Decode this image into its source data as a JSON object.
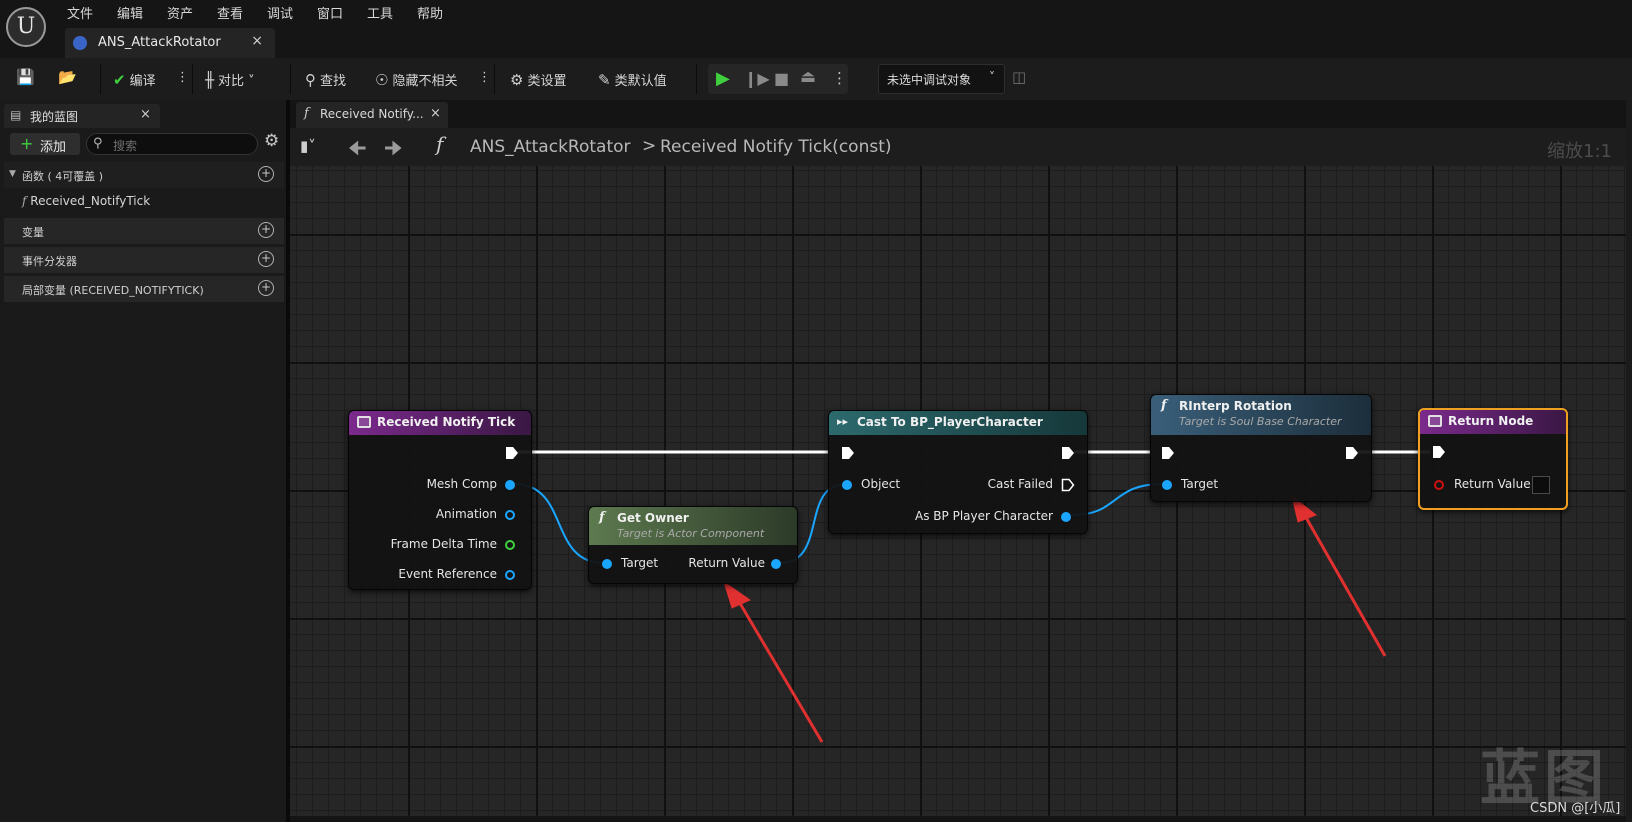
{
  "menu": [
    "文件",
    "编辑",
    "资产",
    "查看",
    "调试",
    "窗口",
    "工具",
    "帮助"
  ],
  "document_tab": {
    "label": "ANS_AttackRotator",
    "close": "×"
  },
  "toolbar": {
    "compile": "编译",
    "diff": "对比",
    "find": "查找",
    "hide_unrelated": "隐藏不相关",
    "class_settings": "类设置",
    "class_defaults": "类默认值",
    "debug_target": "未选中调试对象"
  },
  "left_panel": {
    "tab_label": "我的蓝图",
    "tab_close": "×",
    "add_label": "添加",
    "search_placeholder": "搜索",
    "sections": {
      "functions": "函数 ( 4可覆盖 )",
      "function_item": "Received_NotifyTick",
      "variables": "变量",
      "dispatchers": "事件分发器",
      "locals": "局部变量 (RECEIVED_NOTIFYTICK)"
    }
  },
  "graph": {
    "tab_label": "Received Notify...",
    "tab_close": "×",
    "breadcrumb_root": "ANS_AttackRotator",
    "breadcrumb_sep": ">",
    "breadcrumb_current": "Received Notify Tick(const)",
    "zoom": "缩放1:1",
    "watermark": "蓝图",
    "credit": "CSDN @[小瓜]"
  },
  "nodes": {
    "entry": {
      "title": "Received Notify Tick",
      "pins": [
        "Mesh Comp",
        "Animation",
        "Frame Delta Time",
        "Event Reference"
      ],
      "color": "#7b2a8c"
    },
    "get_owner": {
      "title": "Get Owner",
      "subtitle": "Target is Actor Component",
      "in": "Target",
      "out": "Return Value",
      "color": "#5d7a4f"
    },
    "cast": {
      "title": "Cast To BP_PlayerCharacter",
      "in": "Object",
      "out_exec": "Cast Failed",
      "out": "As BP Player Character",
      "color": "#2c6a6e"
    },
    "rinterp": {
      "title": "RInterp Rotation",
      "subtitle": "Target is Soul Base Character",
      "in": "Target",
      "color": "#3a5f7a"
    },
    "return": {
      "title": "Return Node",
      "pin": "Return Value",
      "color": "#7b2a8c",
      "outline": "#f0a020"
    }
  },
  "colors": {
    "exec_wire": "#ffffff",
    "object_wire": "#1aa6ff",
    "arrow": "#e03030"
  }
}
